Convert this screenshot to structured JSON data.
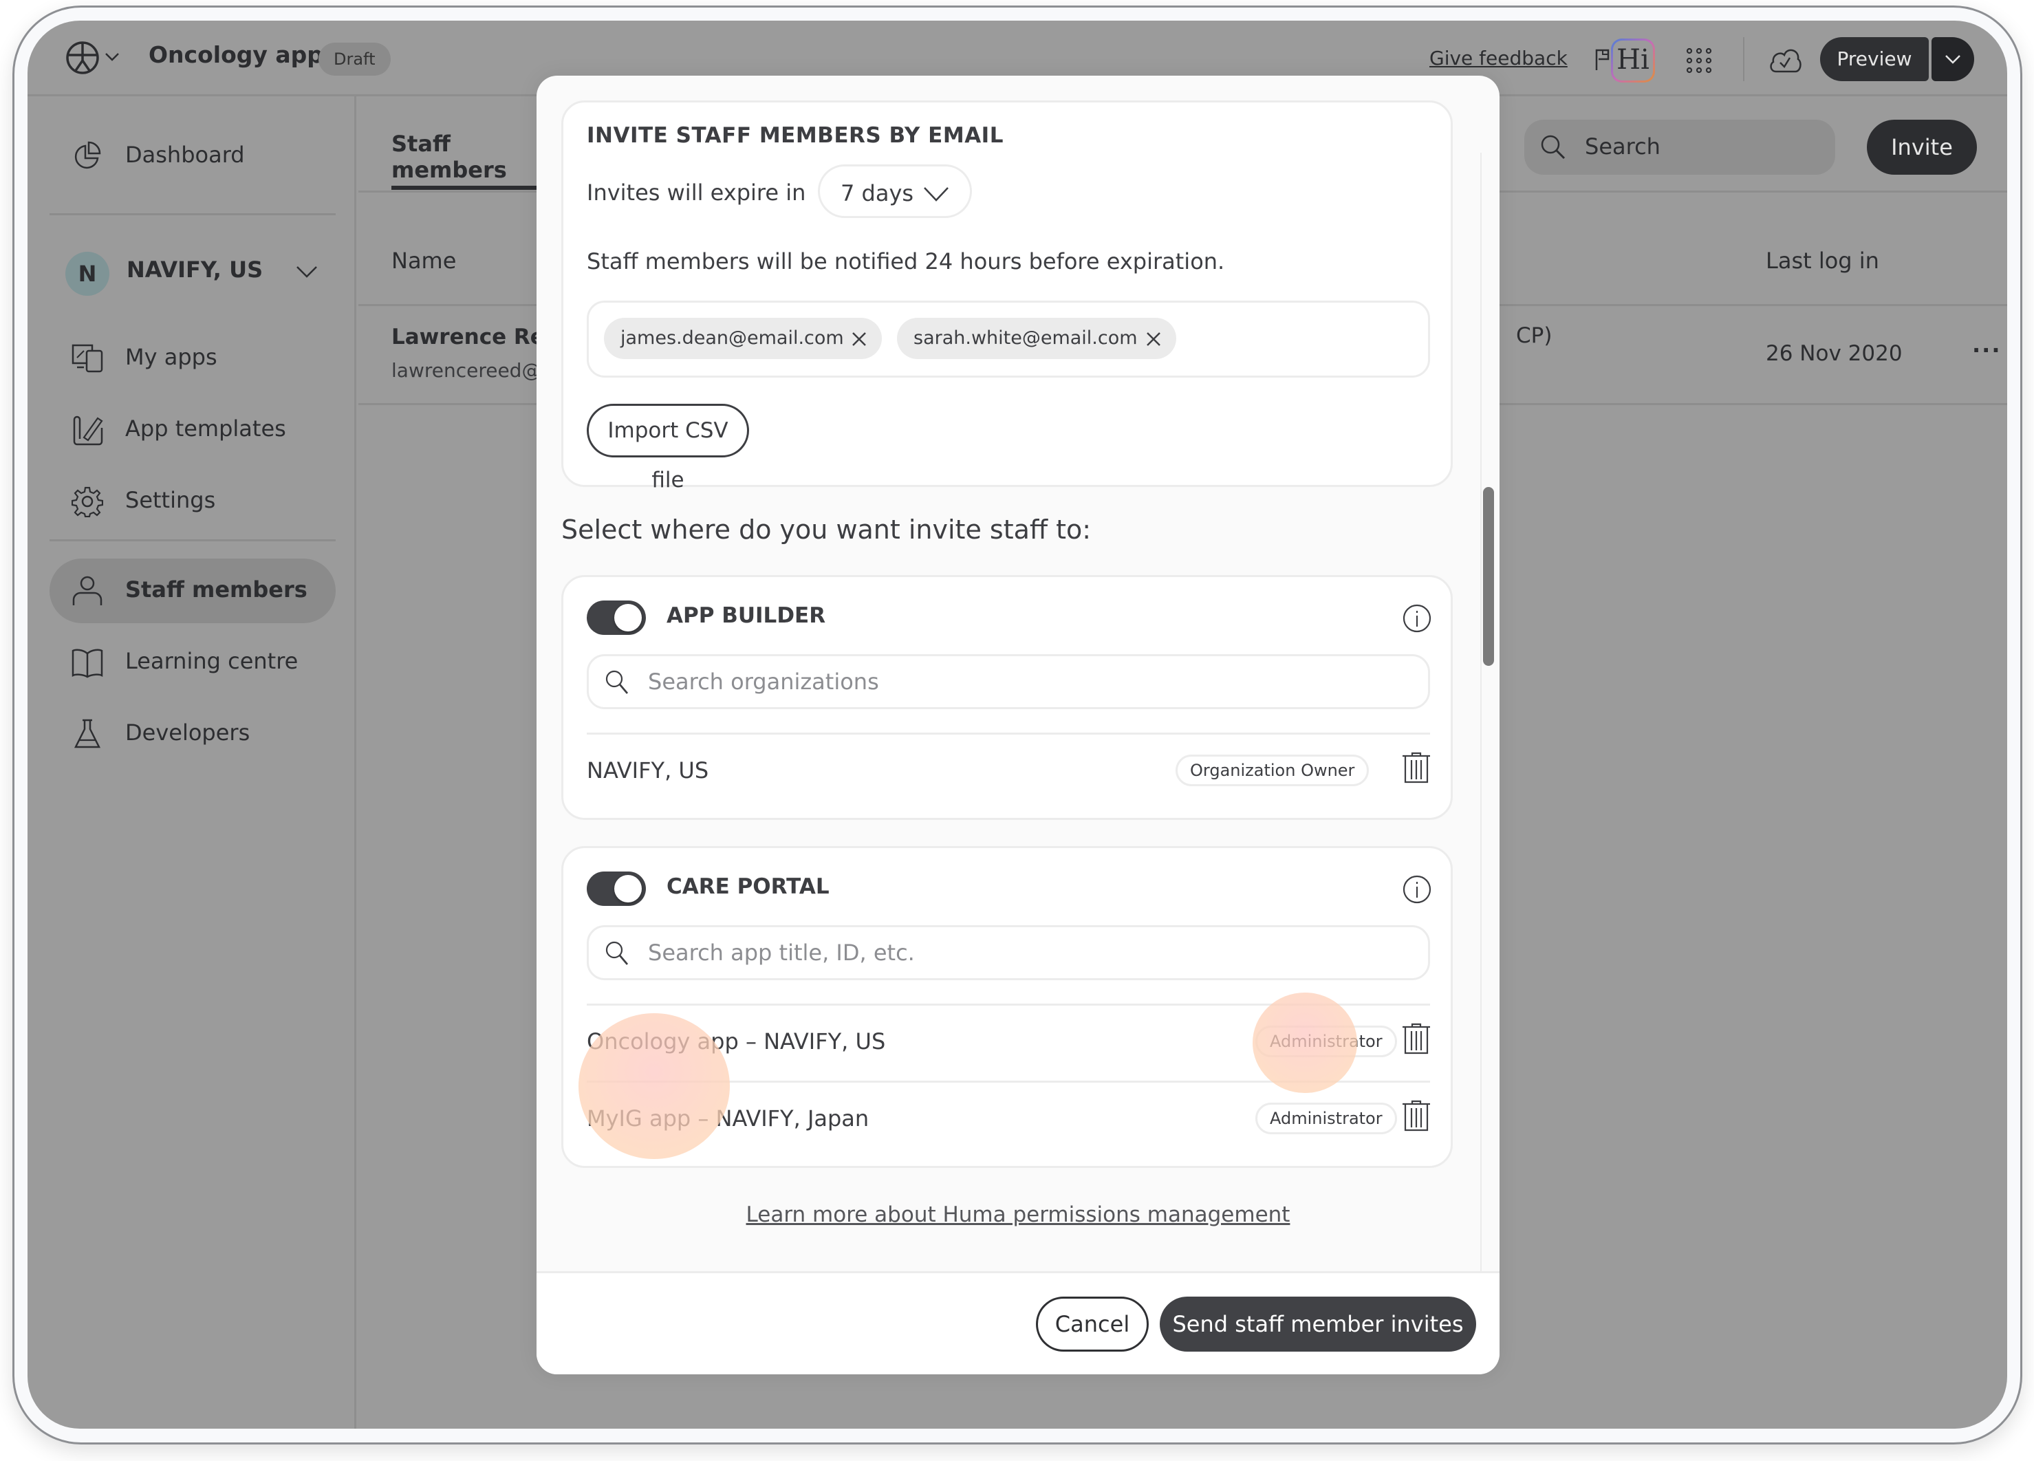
{
  "topbar": {
    "app_title": "Oncology app",
    "status_badge": "Draft",
    "feedback_link": "Give feedback",
    "hi_badge": "Hi",
    "preview_label": "Preview"
  },
  "sidebar": {
    "org": {
      "initial": "N",
      "name": "NAVIFY, US"
    },
    "items": [
      {
        "label": "Dashboard",
        "icon": "pie-chart-icon"
      },
      {
        "label": "My apps",
        "icon": "devices-icon"
      },
      {
        "label": "App templates",
        "icon": "template-ruler-icon"
      },
      {
        "label": "Settings",
        "icon": "gear-icon"
      },
      {
        "label": "Staff members",
        "icon": "person-icon",
        "active": true
      },
      {
        "label": "Learning centre",
        "icon": "book-icon"
      },
      {
        "label": "Developers",
        "icon": "flask-icon"
      }
    ]
  },
  "main": {
    "tab": "Staff members",
    "search_placeholder": "Search",
    "invite_label": "Invite",
    "columns": {
      "name": "Name",
      "last_login": "Last log in"
    },
    "rows": [
      {
        "name": "Lawrence Reed",
        "email": "lawrencereed@email.com",
        "role_fragment": "CP)",
        "last_login": "26 Nov 2020",
        "more": "···"
      }
    ]
  },
  "modal": {
    "email_section": {
      "title": "INVITE STAFF MEMBERS BY EMAIL",
      "expire_label": "Invites will expire in",
      "expire_value": "7 days",
      "notify_text": "Staff members will be notified 24 hours before expiration.",
      "emails": [
        "james.dean@email.com",
        "sarah.white@email.com"
      ],
      "import_csv": "Import CSV file"
    },
    "select_title": "Select where do you want invite staff to:",
    "app_builder": {
      "title": "APP BUILDER",
      "enabled": true,
      "search_placeholder": "Search organizations",
      "entries": [
        {
          "name": "NAVIFY, US",
          "role": "Organization Owner"
        }
      ]
    },
    "care_portal": {
      "title": "CARE PORTAL",
      "enabled": true,
      "search_placeholder": "Search app title, ID, etc.",
      "entries": [
        {
          "name": "Oncology app – NAVIFY, US",
          "role": "Administrator"
        },
        {
          "name": "MyIG app – NAVIFY, Japan",
          "role": "Administrator"
        }
      ]
    },
    "learn_more": "Learn more about Huma permissions management",
    "cancel": "Cancel",
    "send": "Send staff member invites"
  }
}
